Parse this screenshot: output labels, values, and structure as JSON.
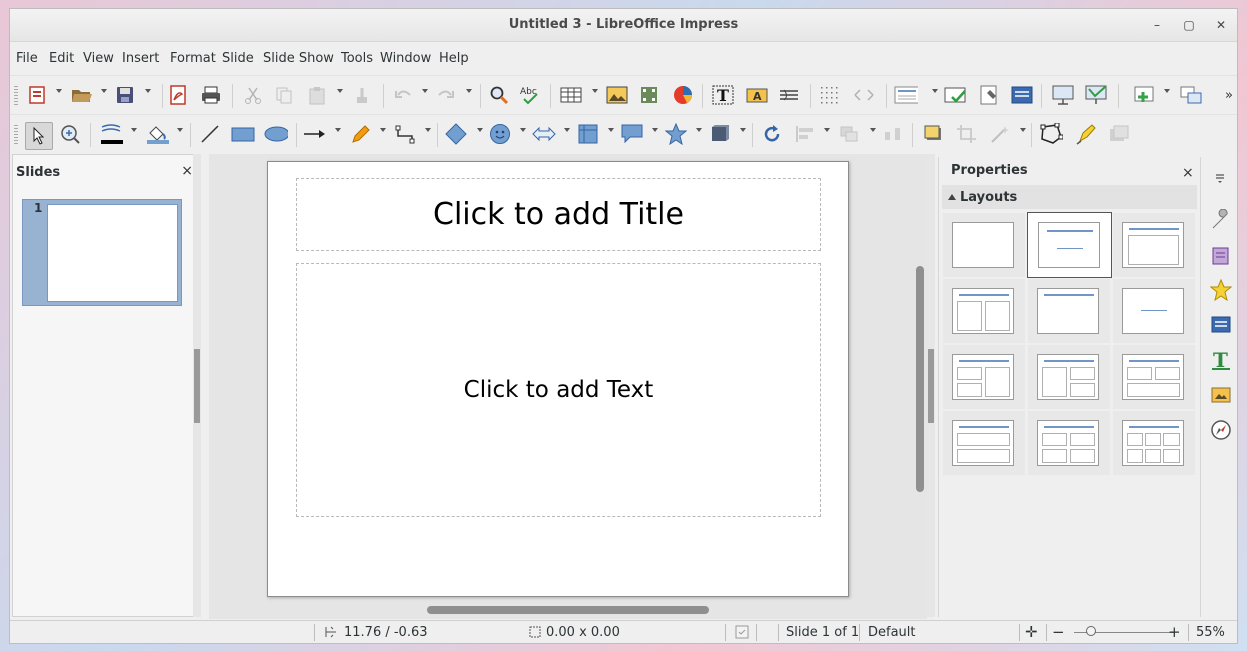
{
  "window": {
    "title": "Untitled 3 - LibreOffice Impress",
    "minimize": "–",
    "maximize": "▢",
    "close": "✕"
  },
  "menu": [
    "File",
    "Edit",
    "View",
    "Insert",
    "Format",
    "Slide",
    "Slide Show",
    "Tools",
    "Window",
    "Help"
  ],
  "slides_pane": {
    "title": "Slides",
    "close": "×",
    "slide_number": "1"
  },
  "slide": {
    "title_placeholder": "Click to add Title",
    "text_placeholder": "Click to add Text"
  },
  "properties": {
    "title": "Properties",
    "close": "×",
    "section": "Layouts"
  },
  "status": {
    "position": "11.76 / -0.63",
    "size": "0.00 x 0.00",
    "slide_info": "Slide 1 of 1",
    "master": "Default",
    "zoom_minus": "−",
    "zoom_plus": "+",
    "zoom": "55%"
  },
  "colors": {
    "accent": "#6f96c6",
    "selection": "#98b2d2"
  }
}
